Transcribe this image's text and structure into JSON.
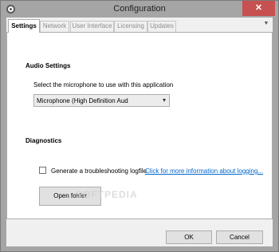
{
  "window": {
    "title": "Configuration",
    "close_label": "✕"
  },
  "tabs": [
    {
      "label": "Settings",
      "active": true
    },
    {
      "label": "Network",
      "active": false
    },
    {
      "label": "User Interface",
      "active": false
    },
    {
      "label": "Licensing",
      "active": false
    },
    {
      "label": "Updates",
      "active": false
    }
  ],
  "tab_menu_icon": "▼",
  "audio": {
    "heading": "Audio Settings",
    "prompt": "Select the microphone to use with this application",
    "microphone_value": "Microphone (High Definition Aud",
    "dropdown_icon": "▾"
  },
  "diagnostics": {
    "heading": "Diagnostics",
    "logfile_label": "Generate a troubleshooting logfile",
    "logfile_checked": false,
    "info_link": "Click for more information about logging...",
    "open_folder_label": "Open folder"
  },
  "watermark": "SOFTPEDIA",
  "footer": {
    "ok_label": "OK",
    "cancel_label": "Cancel"
  }
}
